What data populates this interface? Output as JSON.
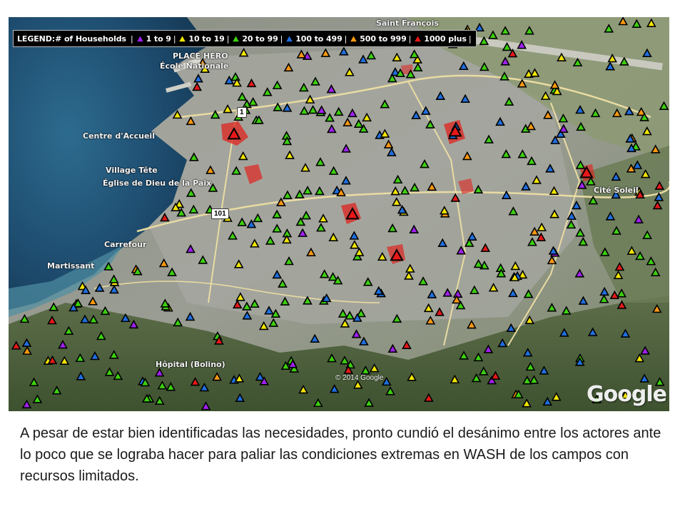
{
  "legend": {
    "title": "LEGEND:# of Households",
    "entries": [
      {
        "label": "1 to 9",
        "color": "#a020f0",
        "icon": "triangle-marker-icon"
      },
      {
        "label": "10 to 19",
        "color": "#f2e600",
        "icon": "triangle-marker-icon"
      },
      {
        "label": "20 to 99",
        "color": "#3dd10f",
        "icon": "triangle-marker-icon"
      },
      {
        "label": "100 to 499",
        "color": "#1f6fe0",
        "icon": "triangle-marker-icon"
      },
      {
        "label": "500 to 999",
        "color": "#ff9a10",
        "icon": "triangle-marker-icon"
      },
      {
        "label": "1000 plus",
        "color": "#e81818",
        "icon": "triangle-marker-icon"
      }
    ]
  },
  "map": {
    "labels": {
      "saint_francois": "Saint François",
      "place_hero": "PLACE HÉRO",
      "ecole_nationale": "École Nationale",
      "centre_accueil": "Centre d'Accueil",
      "village": "Village Tête",
      "eglise": "Église de Dieu de la Paix",
      "carrefour": "Carrefour",
      "martissant": "Martissant",
      "hopital": "Hôpital (Bolino)",
      "cite": "Cité Soleil",
      "route_1": "1",
      "route_101": "101"
    },
    "copyright": "© 2014 Google",
    "logo": "Google"
  },
  "caption": "A pesar de estar bien identificadas las necesidades, pronto cundió el desánimo entre los actores ante lo poco que se lograba hacer para paliar las condiciones extremas en WASH de los campos con recursos limitados."
}
